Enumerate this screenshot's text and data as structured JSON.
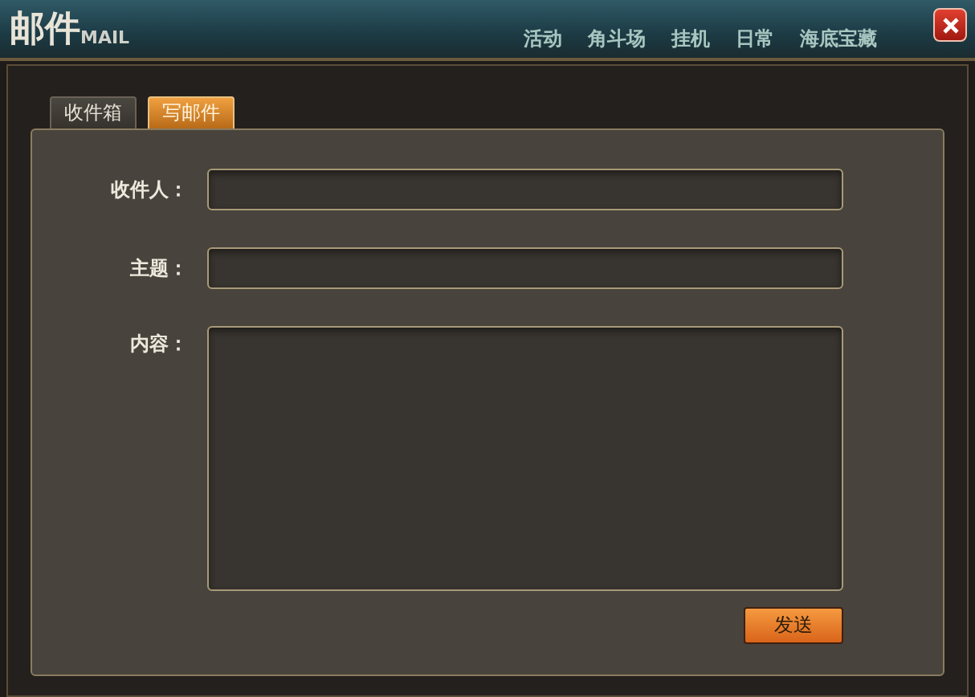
{
  "window": {
    "title": "邮件",
    "subtitle": "MAIL"
  },
  "background_menu": [
    "活动",
    "角斗场",
    "挂机",
    "日常",
    "海底宝藏"
  ],
  "tabs": [
    {
      "label": "收件箱",
      "selected": false
    },
    {
      "label": "写邮件",
      "selected": true
    }
  ],
  "form": {
    "fields": [
      {
        "label": "收件人：",
        "kind": "input"
      },
      {
        "label": "主题：",
        "kind": "input"
      },
      {
        "label": "内容：",
        "kind": "textarea"
      }
    ],
    "send_button": "发送"
  }
}
